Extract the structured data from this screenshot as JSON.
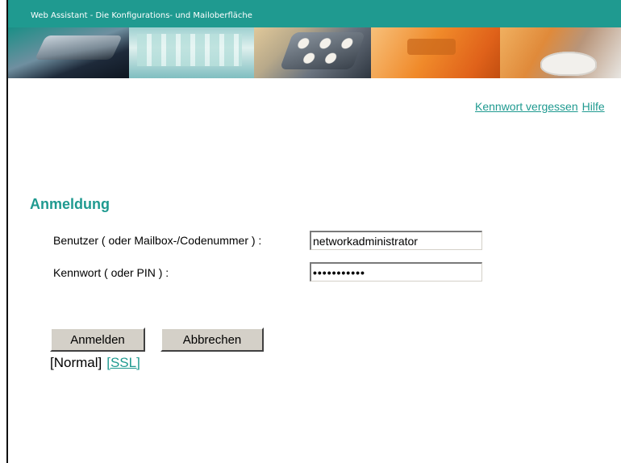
{
  "banner": {
    "title": "Web Assistant - Die Konfigurations- und Mailoberfläche"
  },
  "links": {
    "forgot_password": "Kennwort vergessen",
    "help": "Hilfe"
  },
  "login": {
    "heading": "Anmeldung",
    "user_label": "Benutzer ( oder Mailbox-/Codenummer ) :",
    "user_value": "networkadministrator",
    "password_label": "Kennwort ( oder PIN ) :",
    "password_value": "xxxxxxxxxxx",
    "submit_label": "Anmelden",
    "cancel_label": "Abbrechen"
  },
  "connection": {
    "normal": "[Normal]",
    "ssl": "[SSL]"
  },
  "colors": {
    "accent": "#1f9a90"
  }
}
